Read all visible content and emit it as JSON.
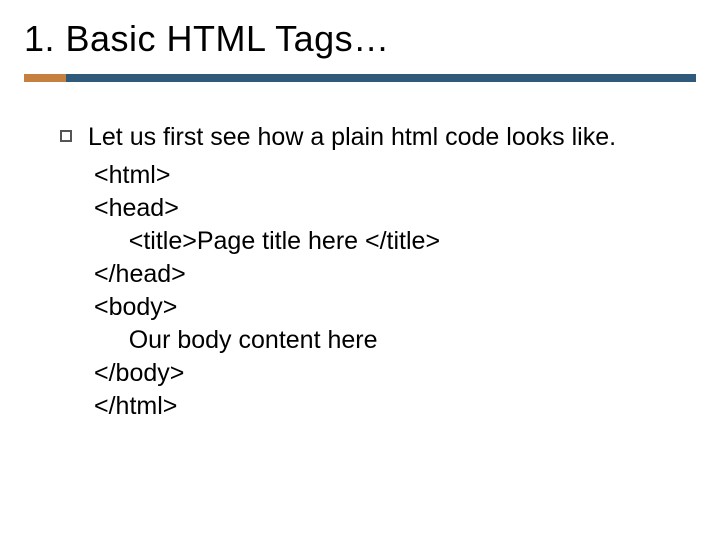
{
  "title": "1. Basic HTML Tags…",
  "lead": "Let us first see how a plain html code looks like.",
  "code": {
    "l1": "<html>",
    "l2": "<head>",
    "l3": "     <title>Page title here </title>",
    "l4": "</head>",
    "l5": "<body>",
    "l6": "     Our body content here",
    "l7": "</body>",
    "l8": "</html>"
  }
}
